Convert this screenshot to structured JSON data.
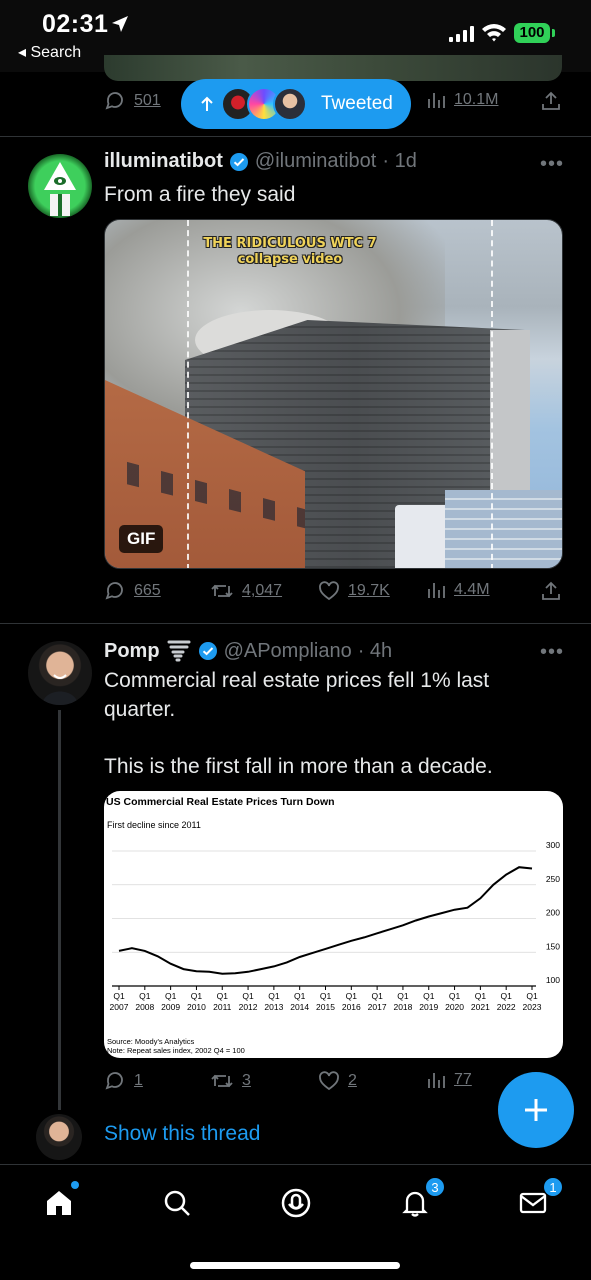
{
  "status_bar": {
    "time": "02:31",
    "back_label": "◂ Search",
    "battery": "100"
  },
  "top_tweet": {
    "replies": "501",
    "views": "10.1M",
    "tweeted_pill_label": "Tweeted"
  },
  "tweet1": {
    "name": "illuminatibot",
    "handle": "@iluminatibot",
    "time": "· 1d",
    "text": "From a fire they said",
    "gif_caption_line1": "THE RIDICULOUS WTC 7",
    "gif_caption_line2": "collapse video",
    "gif_badge": "GIF",
    "replies": "665",
    "retweets": "4,047",
    "likes": "19.7K",
    "views": "4.4M",
    "more": "•••"
  },
  "tweet2": {
    "name": "Pomp",
    "handle": "@APompliano",
    "time": "· 4h",
    "text_line1": "Commercial real estate prices fell 1% last quarter.",
    "text_line2": "This is the first fall in more than a decade.",
    "replies": "1",
    "retweets": "3",
    "likes": "2",
    "views": "77",
    "more": "•••",
    "show_thread": "Show this thread"
  },
  "chart_data": {
    "type": "line",
    "title": "US Commercial Real Estate Prices Turn Down",
    "subtitle": "First decline since 2011",
    "source": "Source: Moody's Analytics",
    "note": "Note: Repeat sales index, 2002 Q4 = 100",
    "ylim": [
      100,
      300
    ],
    "yticks": [
      100,
      150,
      200,
      250,
      300
    ],
    "xticks_top": [
      "Q1",
      "Q1",
      "Q1",
      "Q1",
      "Q1",
      "Q1",
      "Q1",
      "Q1",
      "Q1",
      "Q1",
      "Q1",
      "Q1",
      "Q1",
      "Q1",
      "Q1",
      "Q1",
      "Q1"
    ],
    "xticks_bottom": [
      "2007",
      "2008",
      "2009",
      "2010",
      "2011",
      "2012",
      "2013",
      "2014",
      "2015",
      "2016",
      "2017",
      "2018",
      "2019",
      "2020",
      "2021",
      "2022",
      "2023"
    ],
    "series": [
      {
        "x": [
          2007.0,
          2007.5,
          2008.0,
          2008.5,
          2009.0,
          2009.5,
          2010.0,
          2010.5,
          2011.0,
          2011.5,
          2012.0,
          2012.5,
          2013.0,
          2013.5,
          2014.0,
          2014.5,
          2015.0,
          2015.5,
          2016.0,
          2016.5,
          2017.0,
          2017.5,
          2018.0,
          2018.5,
          2019.0,
          2019.5,
          2020.0,
          2020.5,
          2021.0,
          2021.5,
          2022.0,
          2022.5,
          2023.0
        ],
        "values": [
          152,
          156,
          152,
          144,
          133,
          125,
          122,
          121,
          118,
          119,
          121,
          125,
          129,
          135,
          143,
          149,
          155,
          161,
          167,
          172,
          178,
          184,
          190,
          197,
          203,
          208,
          213,
          216,
          230,
          250,
          265,
          276,
          274
        ]
      }
    ],
    "grid": true
  },
  "nav": {
    "notifications_badge": "3",
    "messages_badge": "1"
  }
}
